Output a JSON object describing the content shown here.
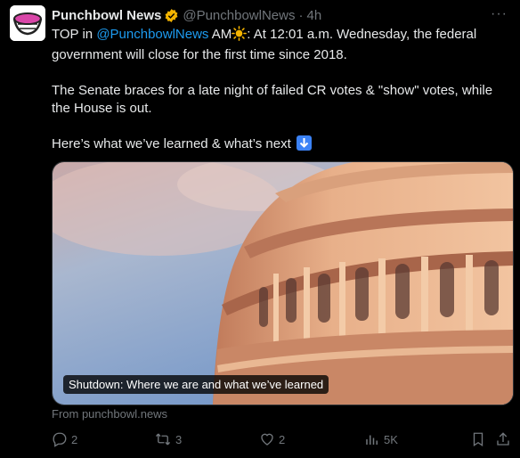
{
  "post": {
    "author_name": "Punchbowl News",
    "handle": "@PunchbowlNews",
    "separator": "·",
    "time": "4h",
    "more_label": "···",
    "text": {
      "p1_prefix": "TOP in ",
      "p1_mention": "@PunchbowlNews",
      "p1_mid": " AM",
      "p1_suffix": ": At 12:01 a.m. Wednesday, the federal government will close for the first time since 2018.",
      "p2": "The Senate braces for a late night of failed CR votes & \"show\" votes, while the House is out.",
      "p3": "Here’s what we’ve learned & what’s next"
    },
    "card": {
      "caption": "Shutdown: Where we are and what we’ve learned",
      "source": "From punchbowl.news"
    },
    "actions": {
      "replies": "2",
      "reposts": "3",
      "likes": "2",
      "views": "5K"
    }
  },
  "icons": [
    "verified-icon",
    "sun-emoji-icon",
    "down-arrow-emoji-icon",
    "reply-icon",
    "repost-icon",
    "like-icon",
    "views-icon",
    "bookmark-icon",
    "share-icon"
  ],
  "colors": {
    "background": "#000000",
    "text": "#e7e9ea",
    "muted": "#71767b",
    "link": "#1d9bf0",
    "verified": "#f4b400"
  }
}
